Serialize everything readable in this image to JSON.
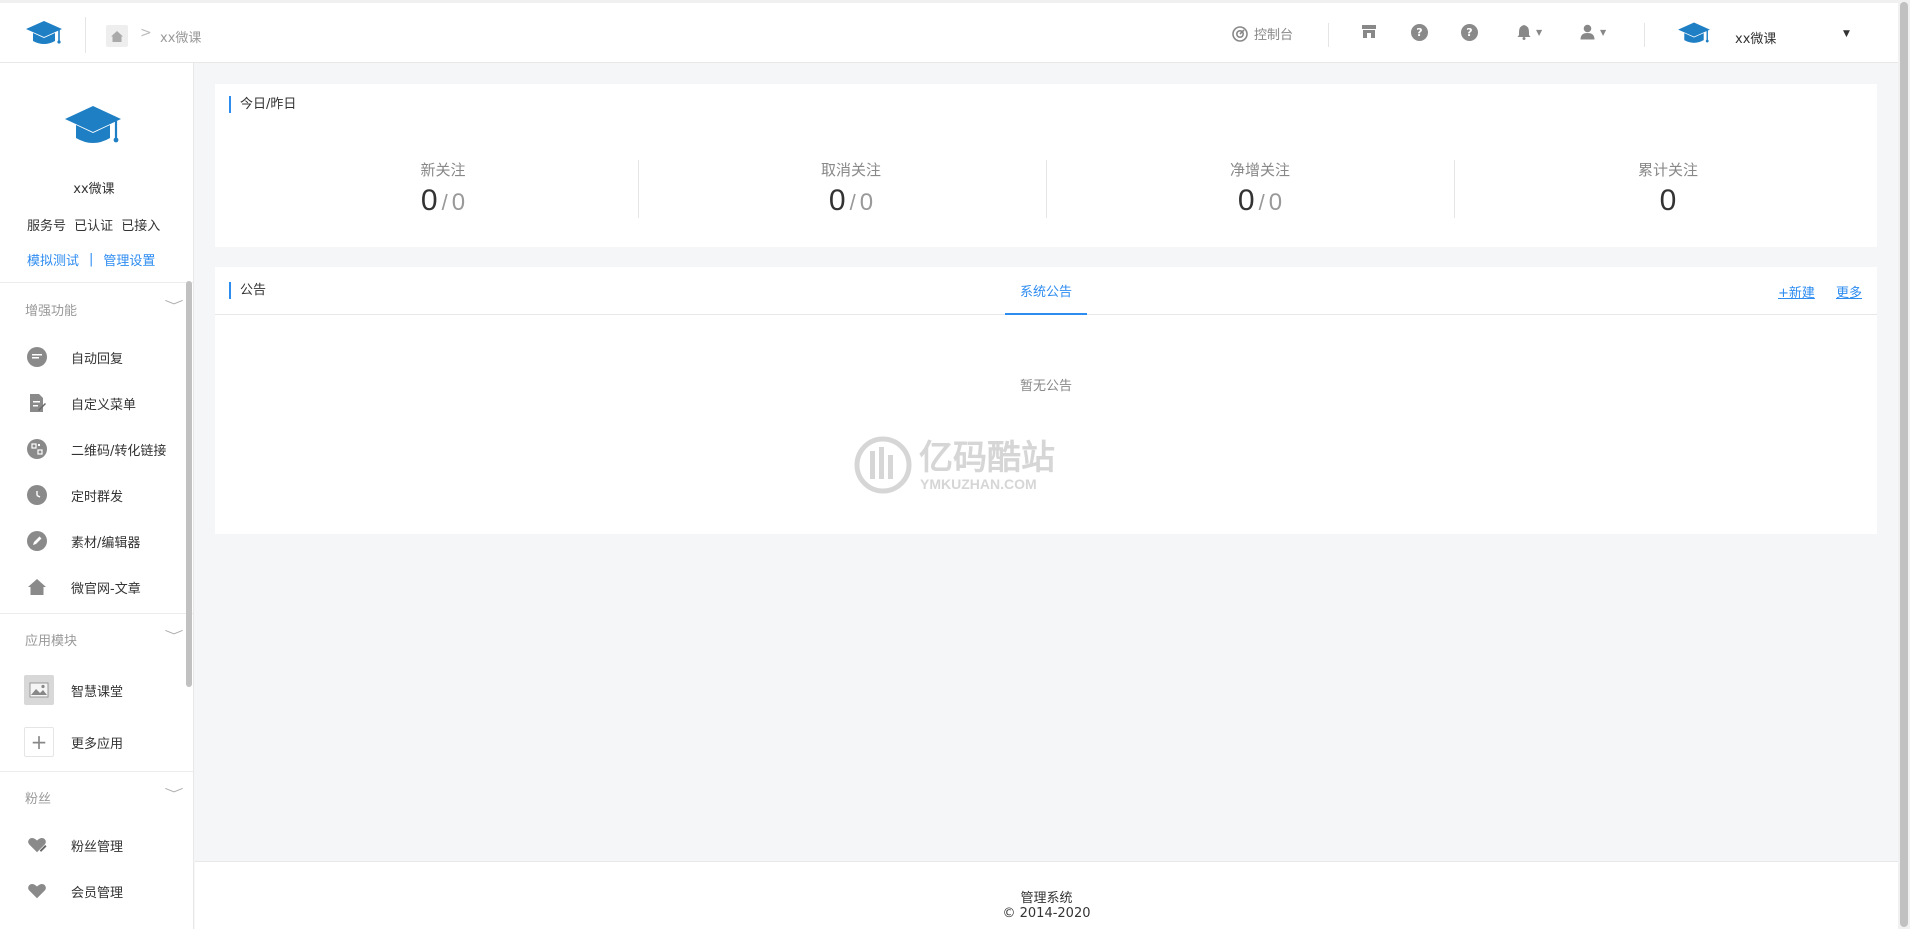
{
  "header": {
    "breadcrumb_text": "xx微课",
    "breadcrumb_sep": ">",
    "console_label": "控制台",
    "account_name": "xx微课"
  },
  "sidebar": {
    "account_name": "xx微课",
    "status": "服务号 已认证 已接入",
    "link_test": "模拟测试",
    "link_sep": "|",
    "link_manage": "管理设置",
    "sections": {
      "enhance": "增强功能",
      "apps": "应用模块",
      "fans": "粉丝"
    },
    "enhance_items": [
      {
        "label": "自动回复",
        "icon": "chat-icon"
      },
      {
        "label": "自定义菜单",
        "icon": "edit-doc-icon"
      },
      {
        "label": "二维码/转化链接",
        "icon": "qrcode-icon"
      },
      {
        "label": "定时群发",
        "icon": "clock-icon"
      },
      {
        "label": "素材/编辑器",
        "icon": "pencil-icon"
      },
      {
        "label": "微官网-文章",
        "icon": "home-icon"
      }
    ],
    "app_items": [
      {
        "label": "智慧课堂",
        "icon": "image-icon"
      },
      {
        "label": "更多应用",
        "icon": "plus-icon"
      }
    ],
    "fans_items": [
      {
        "label": "粉丝管理",
        "icon": "heart-edit-icon"
      },
      {
        "label": "会员管理",
        "icon": "heart-icon"
      }
    ]
  },
  "stats": {
    "title": "今日/昨日",
    "items": [
      {
        "label": "新关注",
        "today": "0",
        "yesterday": "0"
      },
      {
        "label": "取消关注",
        "today": "0",
        "yesterday": "0"
      },
      {
        "label": "净增关注",
        "today": "0",
        "yesterday": "0"
      },
      {
        "label": "累计关注",
        "today": "0"
      }
    ]
  },
  "notice": {
    "title": "公告",
    "tab": "系统公告",
    "new_label": "+新建",
    "more_label": "更多",
    "empty": "暂无公告"
  },
  "watermark": {
    "cn": "亿码酷站",
    "en": "YMKUZHAN.COM"
  },
  "footer": {
    "line1": "管理系统",
    "line2": "© 2014-2020"
  },
  "colors": {
    "accent": "#2d8cf0",
    "logo": "#1f7fc4"
  }
}
